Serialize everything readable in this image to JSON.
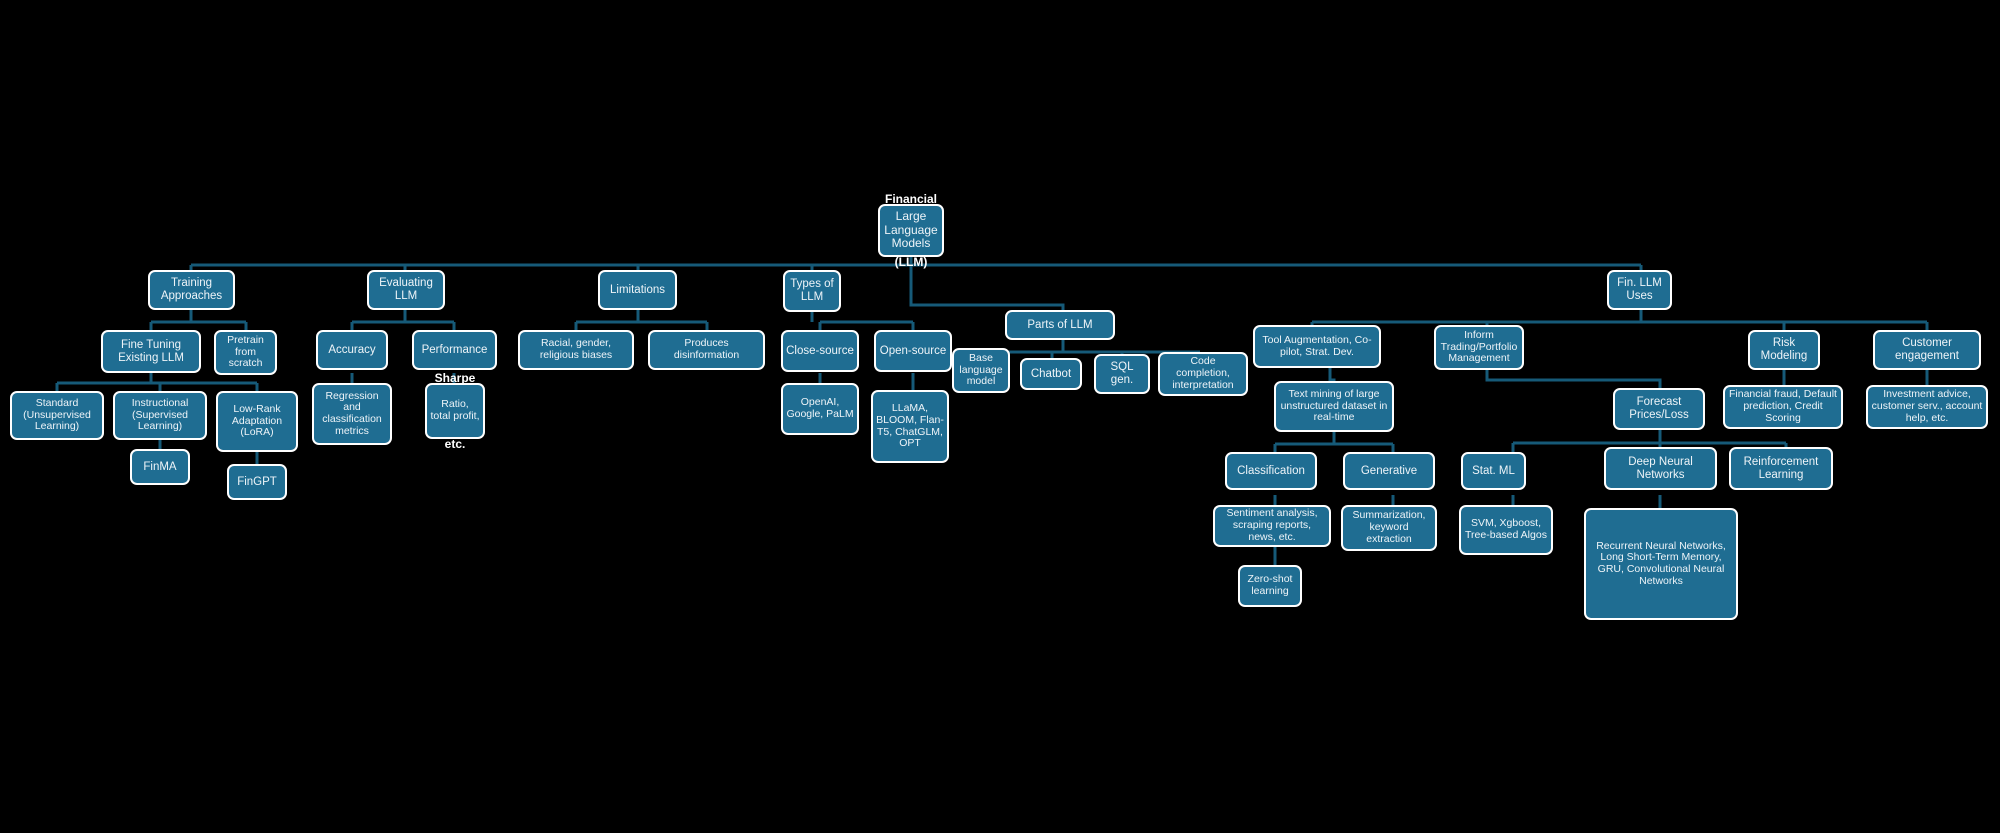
{
  "diagram": {
    "title_root_above": "Financial",
    "title_root_below": "(LLM)",
    "background_color": "#000000",
    "node_fill": "#1f6d92",
    "node_border": "#ffffff",
    "connector_color": "#165a78",
    "text_color": "#eef4f8"
  },
  "nodes": {
    "root": "Large Language Models",
    "training_approaches": "Training Approaches",
    "fine_tuning_existing_llm": "Fine Tuning Existing LLM",
    "pretrain_from_scratch": "Pretrain from scratch",
    "standard_unsupervised": "Standard (Unsupervised Learning)",
    "instructional_supervised": "Instructional (Supervised Learning)",
    "low_rank_adaptation": "Low-Rank Adaptation (LoRA)",
    "finma": "FinMA",
    "fingpt": "FinGPT",
    "evaluating_llm": "Evaluating LLM",
    "accuracy": "Accuracy",
    "performance": "Performance",
    "regression_classification_metrics": "Regression and classification metrics",
    "sharpe_over_top": "Sharpe",
    "sharpe_box": "Ratio, total profit,",
    "sharpe_over_bot": "etc.",
    "limitations": "Limitations",
    "racial_gender_religious_biases": "Racial, gender, religious biases",
    "produces_disinformation": "Produces disinformation",
    "types_of_llm": "Types of LLM",
    "close_source": "Close-source",
    "open_source": "Open-source",
    "openai_google_palm": "OpenAI, Google, PaLM",
    "llama_bloom_flant5_chatglm_opt": "LLaMA, BLOOM, Flan-T5, ChatGLM, OPT",
    "parts_of_llm": "Parts of LLM",
    "base_language_model": "Base language model",
    "chatbot": "Chatbot",
    "sql_gen": "SQL gen.",
    "code_completion_interpretation": "Code completion, interpretation",
    "fin_llm_uses": "Fin. LLM Uses",
    "tool_augmentation": "Tool Augmentation, Co-pilot, Strat. Dev.",
    "inform_trading_portfolio": "Inform Trading/Portfolio Management",
    "risk_modeling": "Risk Modeling",
    "customer_engagement": "Customer engagement",
    "text_mining": "Text mining of large unstructured dataset in real-time",
    "classification": "Classification",
    "generative": "Generative",
    "sentiment_analysis": "Sentiment analysis, scraping reports, news, etc.",
    "summarization_keyword": "Summarization, keyword extraction",
    "zero_shot_learning": "Zero-shot learning",
    "forecast_prices_loss": "Forecast Prices/Loss",
    "stat_ml": "Stat. ML",
    "deep_neural_networks": "Deep Neural Networks",
    "reinforcement_learning": "Reinforcement Learning",
    "svm_xgboost_tree": "SVM, Xgboost, Tree-based Algos",
    "rnn_lstm_gru_cnn": "Recurrent Neural Networks, Long Short-Term Memory, GRU, Convolutional Neural Networks",
    "financial_fraud_default_credit": "Financial fraud, Default prediction, Credit Scoring",
    "investment_advice_customer_serv": "Investment advice, customer serv., account help, etc."
  }
}
